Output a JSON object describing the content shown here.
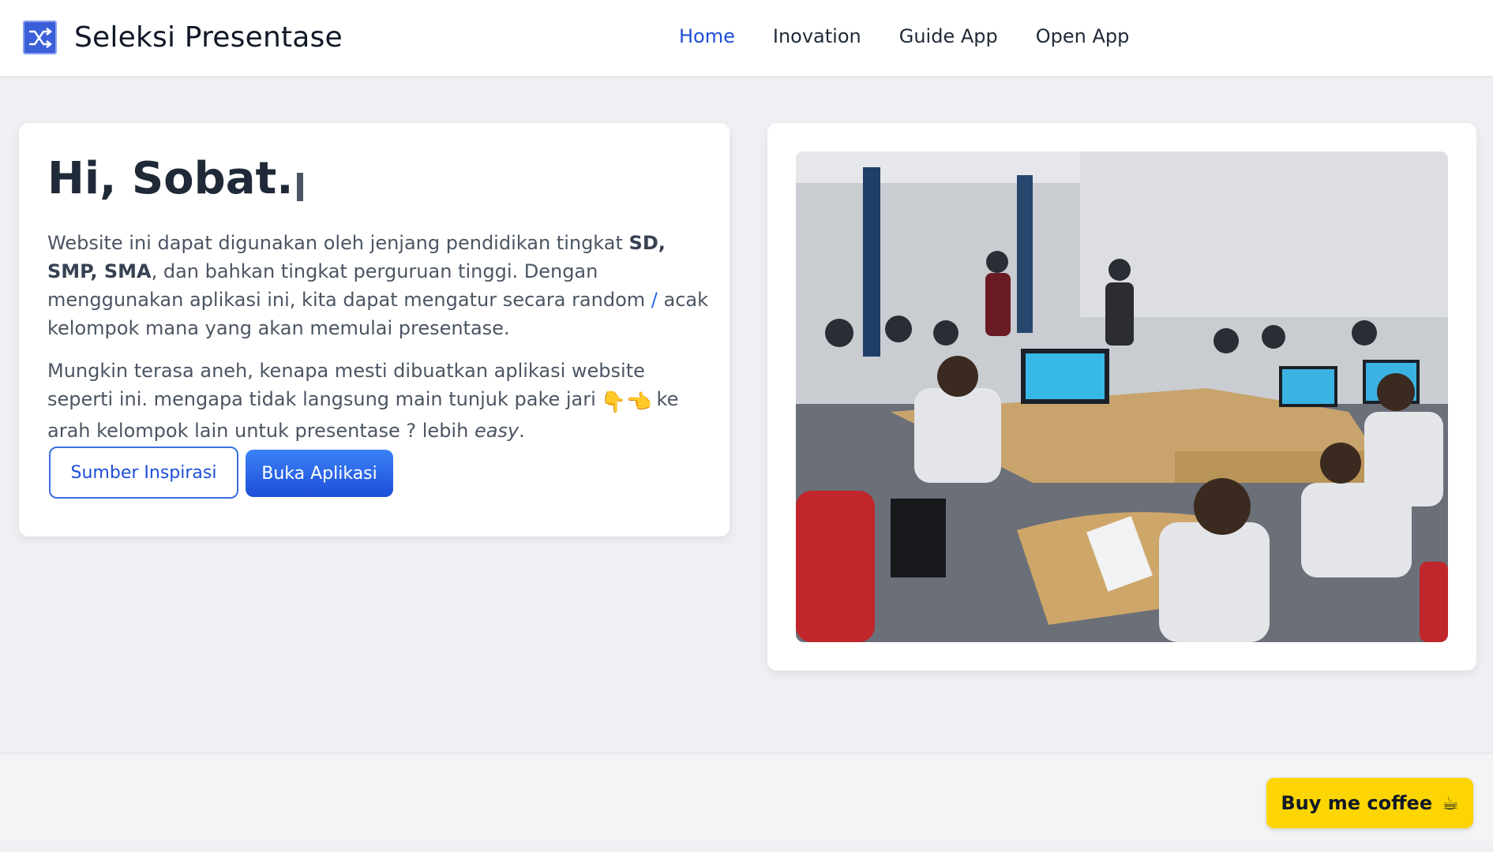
{
  "header": {
    "brand_title": "Seleksi Presentase",
    "brand_icon": "shuffle-icon",
    "nav": [
      {
        "label": "Home",
        "active": true
      },
      {
        "label": "Inovation",
        "active": false
      },
      {
        "label": "Guide App",
        "active": false
      },
      {
        "label": "Open App",
        "active": false
      }
    ]
  },
  "hero": {
    "title": "Hi, Sobat.",
    "para1": {
      "t1": "Website ini dapat digunakan oleh jenjang pendidikan tingkat ",
      "bold": "SD, SMP, SMA",
      "t2": ", dan bahkan tingkat perguruan tinggi. Dengan menggunakan aplikasi ini, kita dapat mengatur secara random ",
      "slash": "/",
      "t3": " acak kelompok mana yang akan memulai presentase."
    },
    "para2": {
      "t1": "Mungkin terasa aneh, kenapa mesti dibuatkan aplikasi website seperti ini. mengapa tidak langsung main tunjuk pake jari",
      "emoji": "👇👈",
      "t2": "ke arah kelompok lain untuk presentase ? lebih ",
      "italic": "easy",
      "t3": "."
    },
    "btn_inspiration": "Sumber Inspirasi",
    "btn_open": "Buka Aplikasi"
  },
  "image": {
    "description_icon": "classroom-photo"
  },
  "footer": {
    "coffee_label": "Buy me coffee",
    "coffee_icon": "☕"
  },
  "colors": {
    "accent": "#1d4ed8",
    "coffee": "#fcd503",
    "background": "#eef0f3"
  }
}
